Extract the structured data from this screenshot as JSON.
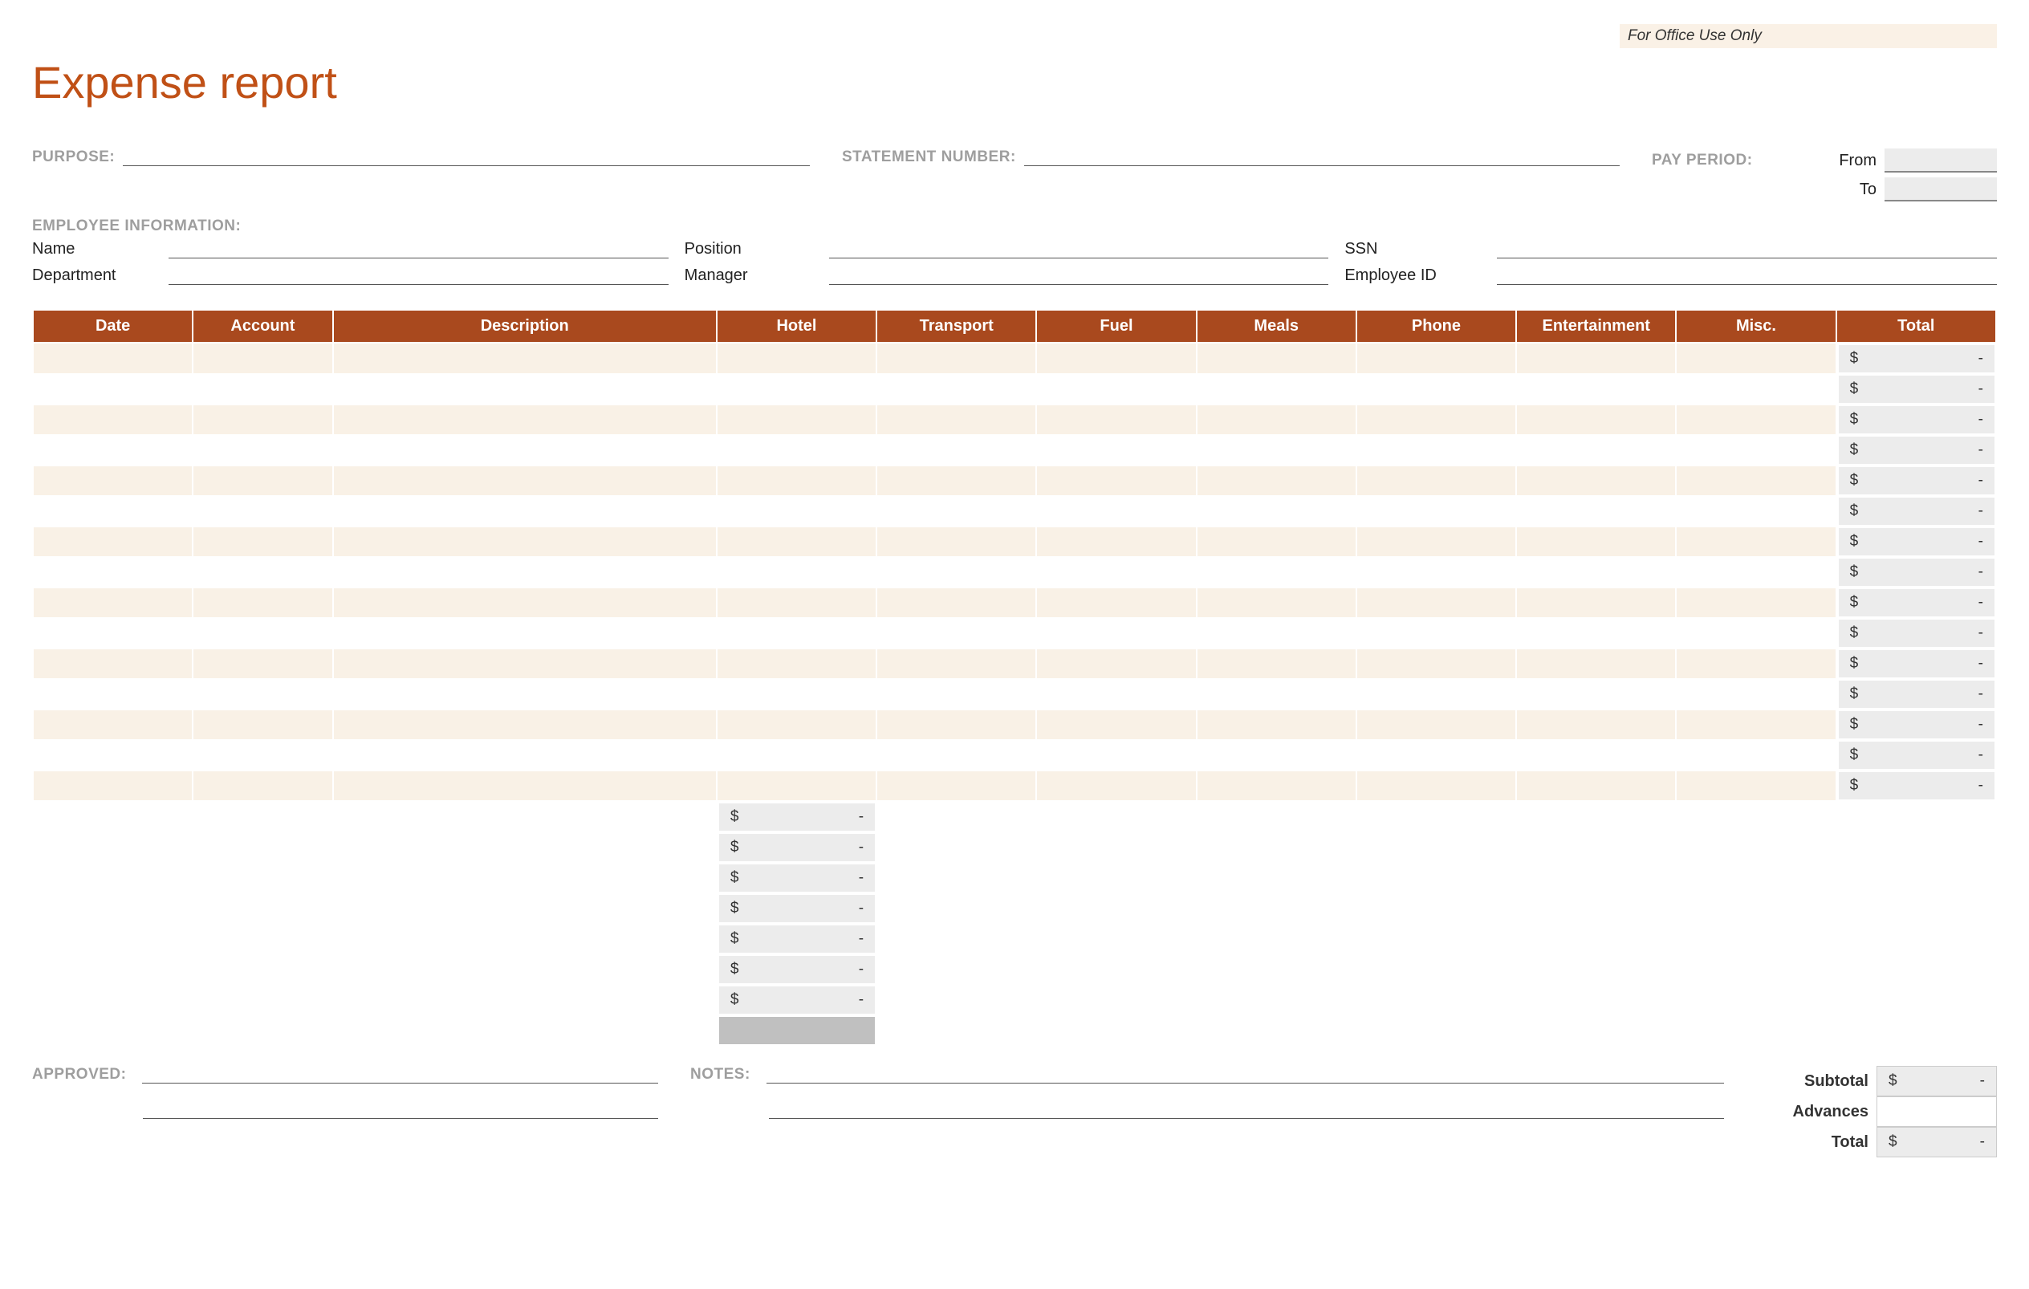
{
  "office_use": "For Office Use Only",
  "title": "Expense report",
  "labels": {
    "purpose": "PURPOSE:",
    "statement_number": "STATEMENT NUMBER:",
    "pay_period": "PAY PERIOD:",
    "from": "From",
    "to": "To",
    "employee_info": "EMPLOYEE INFORMATION:",
    "name": "Name",
    "position": "Position",
    "ssn": "SSN",
    "department": "Department",
    "manager": "Manager",
    "employee_id": "Employee ID",
    "approved": "APPROVED:",
    "notes": "NOTES:",
    "subtotal": "Subtotal",
    "advances": "Advances",
    "total": "Total"
  },
  "columns": [
    "Date",
    "Account",
    "Description",
    "Hotel",
    "Transport",
    "Fuel",
    "Meals",
    "Phone",
    "Entertainment",
    "Misc.",
    "Total"
  ],
  "row_total": {
    "currency": "$",
    "value": "-"
  },
  "col_total": {
    "currency": "$",
    "value": "-"
  },
  "summary": {
    "subtotal": {
      "currency": "$",
      "value": "-"
    },
    "advances": {
      "currency": "",
      "value": ""
    },
    "total": {
      "currency": "$",
      "value": "-"
    }
  },
  "row_count": 15
}
